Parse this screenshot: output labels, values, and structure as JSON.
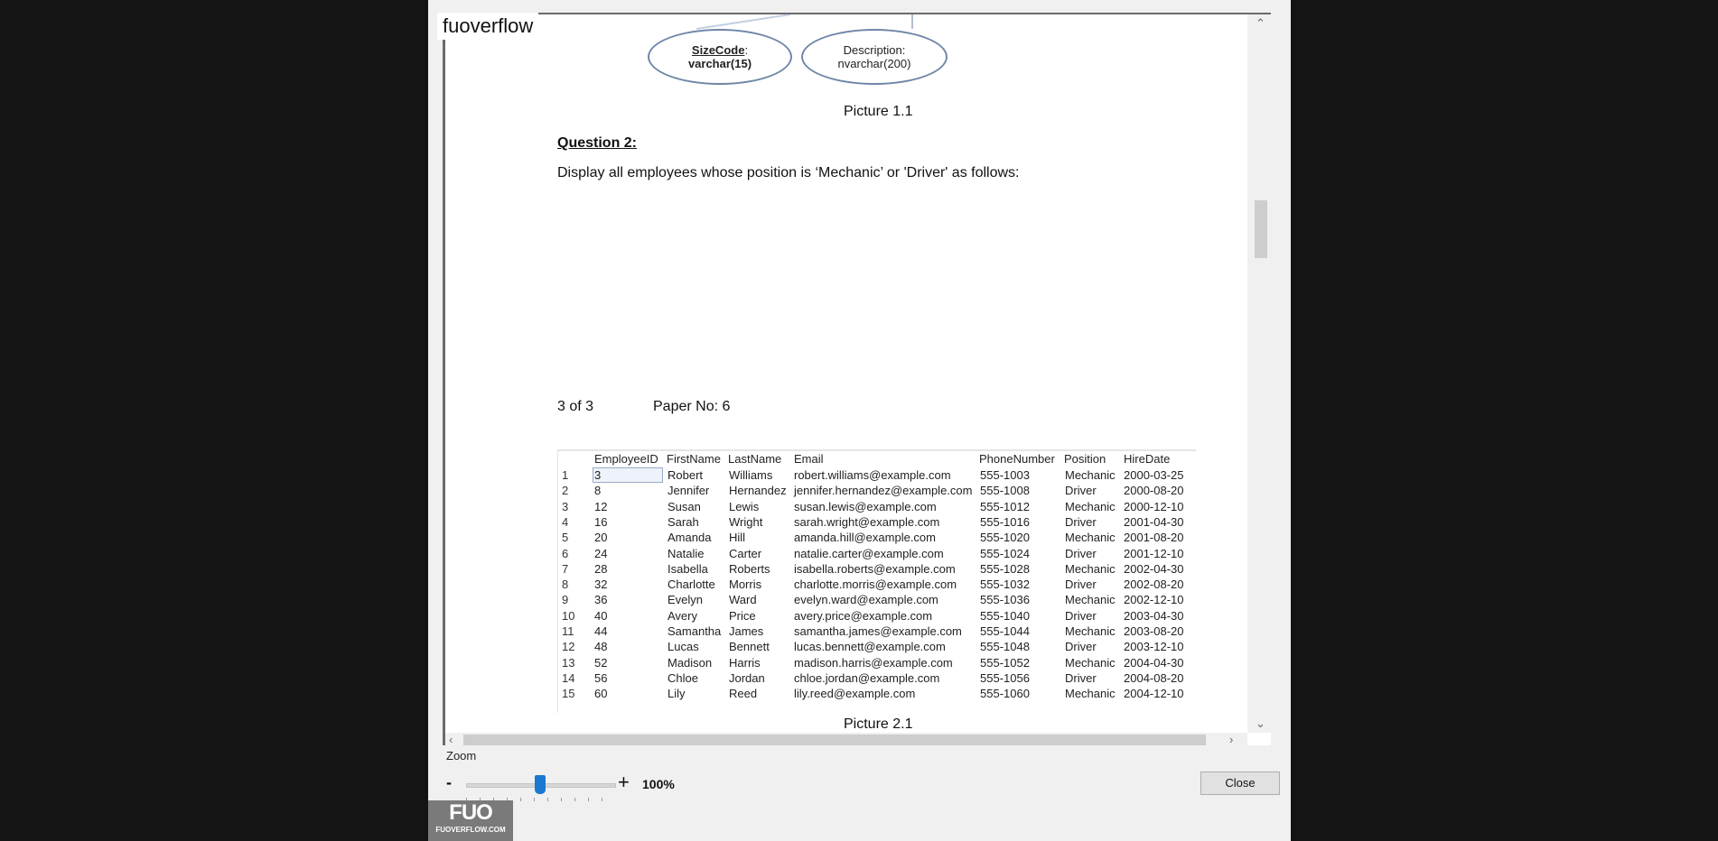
{
  "watermark": "fuoverflow",
  "diagram": {
    "size_code_label": "SizeCode",
    "size_code_colon": ":",
    "size_code_type": "varchar(15)",
    "description_label": "Description:",
    "description_type": "nvarchar(200)",
    "caption": "Picture 1.1"
  },
  "question": {
    "heading": "Question 2:",
    "text": "Display all employees whose position is ‘Mechanic’ or 'Driver' as follows:"
  },
  "page_info": {
    "page": "3 of 3",
    "paper": "Paper No: 6"
  },
  "results": {
    "columns": [
      "EmployeeID",
      "FirstName",
      "LastName",
      "Email",
      "PhoneNumber",
      "Position",
      "HireDate"
    ],
    "rows": [
      [
        "1",
        "3",
        "Robert",
        "Williams",
        "robert.williams@example.com",
        "555-1003",
        "Mechanic",
        "2000-03-25"
      ],
      [
        "2",
        "8",
        "Jennifer",
        "Hernandez",
        "jennifer.hernandez@example.com",
        "555-1008",
        "Driver",
        "2000-08-20"
      ],
      [
        "3",
        "12",
        "Susan",
        "Lewis",
        "susan.lewis@example.com",
        "555-1012",
        "Mechanic",
        "2000-12-10"
      ],
      [
        "4",
        "16",
        "Sarah",
        "Wright",
        "sarah.wright@example.com",
        "555-1016",
        "Driver",
        "2001-04-30"
      ],
      [
        "5",
        "20",
        "Amanda",
        "Hill",
        "amanda.hill@example.com",
        "555-1020",
        "Mechanic",
        "2001-08-20"
      ],
      [
        "6",
        "24",
        "Natalie",
        "Carter",
        "natalie.carter@example.com",
        "555-1024",
        "Driver",
        "2001-12-10"
      ],
      [
        "7",
        "28",
        "Isabella",
        "Roberts",
        "isabella.roberts@example.com",
        "555-1028",
        "Mechanic",
        "2002-04-30"
      ],
      [
        "8",
        "32",
        "Charlotte",
        "Morris",
        "charlotte.morris@example.com",
        "555-1032",
        "Driver",
        "2002-08-20"
      ],
      [
        "9",
        "36",
        "Evelyn",
        "Ward",
        "evelyn.ward@example.com",
        "555-1036",
        "Mechanic",
        "2002-12-10"
      ],
      [
        "10",
        "40",
        "Avery",
        "Price",
        "avery.price@example.com",
        "555-1040",
        "Driver",
        "2003-04-30"
      ],
      [
        "11",
        "44",
        "Samantha",
        "James",
        "samantha.james@example.com",
        "555-1044",
        "Mechanic",
        "2003-08-20"
      ],
      [
        "12",
        "48",
        "Lucas",
        "Bennett",
        "lucas.bennett@example.com",
        "555-1048",
        "Driver",
        "2003-12-10"
      ],
      [
        "13",
        "52",
        "Madison",
        "Harris",
        "madison.harris@example.com",
        "555-1052",
        "Mechanic",
        "2004-04-30"
      ],
      [
        "14",
        "56",
        "Chloe",
        "Jordan",
        "chloe.jordan@example.com",
        "555-1056",
        "Driver",
        "2004-08-20"
      ],
      [
        "15",
        "60",
        "Lily",
        "Reed",
        "lily.reed@example.com",
        "555-1060",
        "Mechanic",
        "2004-12-10"
      ]
    ],
    "caption": "Picture 2.1"
  },
  "zoom": {
    "label": "Zoom",
    "minus": "-",
    "plus": "+",
    "value": "100%",
    "level_fraction": 0.5
  },
  "close_label": "Close",
  "logo": {
    "mark": "FUO",
    "site": "FUOVERFLOW.COM"
  },
  "colors": {
    "accent": "#1a78d0",
    "diagram_stroke": "#6f86a8"
  }
}
